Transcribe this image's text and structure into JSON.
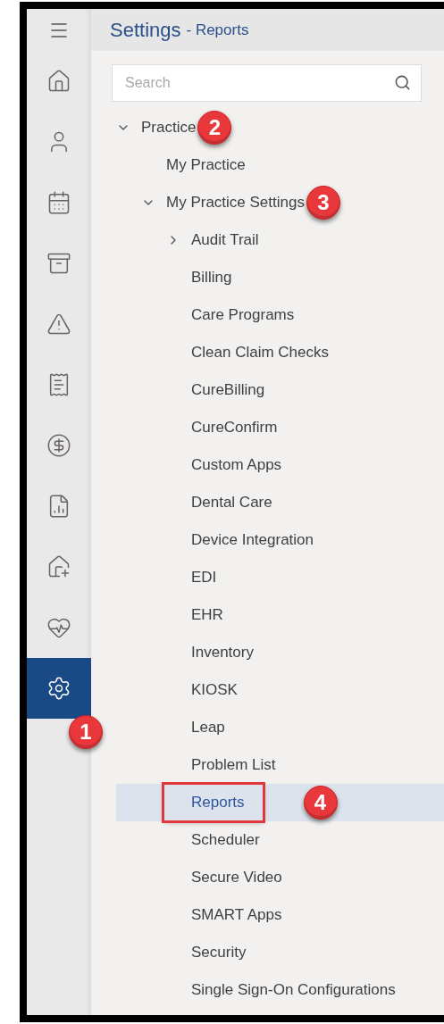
{
  "header": {
    "title": "Settings",
    "subtitle": "- Reports"
  },
  "rail": [
    {
      "kind": "home",
      "selected": false
    },
    {
      "kind": "person",
      "selected": false
    },
    {
      "kind": "calendar",
      "selected": false
    },
    {
      "kind": "cabinet",
      "selected": false
    },
    {
      "kind": "alert",
      "selected": false
    },
    {
      "kind": "bill",
      "selected": false
    },
    {
      "kind": "coins",
      "selected": false
    },
    {
      "kind": "chart",
      "selected": false
    },
    {
      "kind": "house-phone",
      "selected": false
    },
    {
      "kind": "heart",
      "selected": false
    },
    {
      "kind": "settings",
      "selected": true,
      "callout": "1"
    }
  ],
  "search": {
    "placeholder": "Search"
  },
  "tree": [
    {
      "label": "Practice",
      "expanded": true,
      "selected": false,
      "callout": "2",
      "children": [
        {
          "label": "My Practice",
          "selected": false
        },
        {
          "label": "My Practice Settings",
          "expanded": true,
          "selected": false,
          "callout": "3",
          "children": [
            {
              "label": "Audit Trail",
              "expanded": false,
              "selected": false
            },
            {
              "label": "Billing",
              "selected": false
            },
            {
              "label": "Care Programs",
              "selected": false
            },
            {
              "label": "Clean Claim Checks",
              "selected": false
            },
            {
              "label": "CureBilling",
              "selected": false
            },
            {
              "label": "CureConfirm",
              "selected": false
            },
            {
              "label": "Custom Apps",
              "selected": false
            },
            {
              "label": "Dental Care",
              "selected": false
            },
            {
              "label": "Device Integration",
              "selected": false
            },
            {
              "label": "EDI",
              "selected": false
            },
            {
              "label": "EHR",
              "selected": false
            },
            {
              "label": "Inventory",
              "selected": false
            },
            {
              "label": "KIOSK",
              "selected": false
            },
            {
              "label": "Leap",
              "selected": false
            },
            {
              "label": "Problem List",
              "selected": false
            },
            {
              "label": "Reports",
              "selected": true,
              "highlighted": true,
              "callout": "4"
            },
            {
              "label": "Scheduler",
              "selected": false
            },
            {
              "label": "Secure Video",
              "selected": false
            },
            {
              "label": "SMART Apps",
              "selected": false
            },
            {
              "label": "Security",
              "selected": false
            },
            {
              "label": "Single Sign-On Configurations",
              "selected": false
            }
          ]
        }
      ]
    }
  ]
}
